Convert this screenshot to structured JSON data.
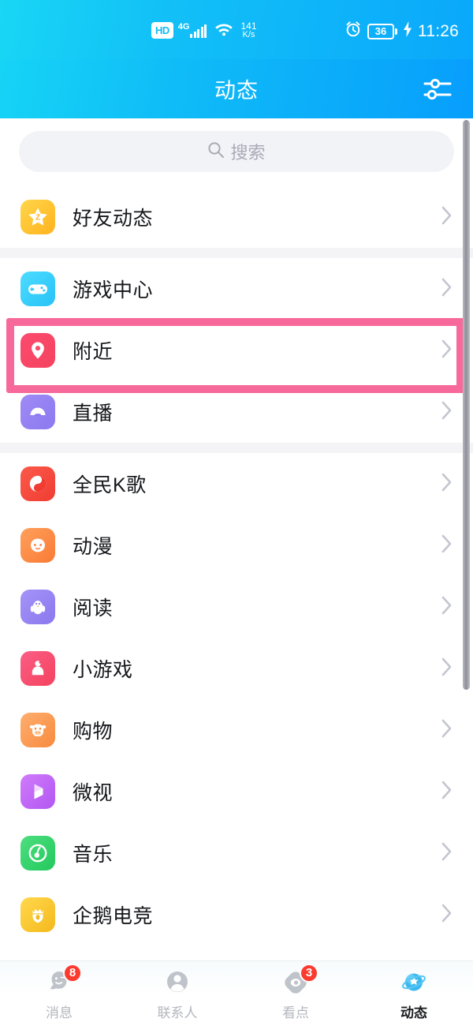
{
  "status_bar": {
    "hd_label": "HD",
    "network_label": "4G",
    "speed_value": "141",
    "speed_unit": "K/s",
    "battery_level": "36",
    "time": "11:26",
    "icons": [
      "hd-icon",
      "signal-bars-icon",
      "wifi-icon",
      "alarm-clock-icon",
      "battery-icon",
      "charging-bolt-icon"
    ]
  },
  "app_bar": {
    "title": "动态",
    "action_icon": "filter-sliders-icon"
  },
  "search": {
    "placeholder": "搜索",
    "icon": "search-icon"
  },
  "colors": {
    "header_start": "#16d4f6",
    "header_end": "#079efc",
    "highlight": "#f7699a",
    "badge": "#fb3b30",
    "divider": "#f4f4f6"
  },
  "sections": [
    {
      "items": [
        {
          "label": "好友动态",
          "icon": "friend-feed-star-icon",
          "chevron": "›"
        }
      ]
    },
    {
      "items": [
        {
          "label": "游戏中心",
          "icon": "gamepad-icon",
          "chevron": "›"
        },
        {
          "label": "附近",
          "icon": "location-pin-icon",
          "chevron": "›",
          "highlighted": true
        },
        {
          "label": "直播",
          "icon": "live-broadcast-icon",
          "chevron": "›"
        }
      ]
    },
    {
      "items": [
        {
          "label": "全民K歌",
          "icon": "karaoke-icon",
          "chevron": "›"
        },
        {
          "label": "动漫",
          "icon": "anime-icon",
          "chevron": "›"
        },
        {
          "label": "阅读",
          "icon": "reading-penguin-icon",
          "chevron": "›"
        },
        {
          "label": "小游戏",
          "icon": "mini-game-joystick-icon",
          "chevron": "›"
        },
        {
          "label": "购物",
          "icon": "shopping-cow-icon",
          "chevron": "›"
        },
        {
          "label": "微视",
          "icon": "weishi-video-icon",
          "chevron": "›"
        },
        {
          "label": "音乐",
          "icon": "music-icon",
          "chevron": "›"
        },
        {
          "label": "企鹅电竞",
          "icon": "esports-crown-icon",
          "chevron": "›"
        }
      ]
    }
  ],
  "bottom_nav": [
    {
      "label": "消息",
      "icon": "message-penguin-icon",
      "badge": "8",
      "active": false
    },
    {
      "label": "联系人",
      "icon": "contacts-person-icon",
      "badge": "",
      "active": false
    },
    {
      "label": "看点",
      "icon": "kandian-eye-icon",
      "badge": "3",
      "active": false
    },
    {
      "label": "动态",
      "icon": "dynamic-planet-icon",
      "badge": "",
      "active": true
    }
  ]
}
